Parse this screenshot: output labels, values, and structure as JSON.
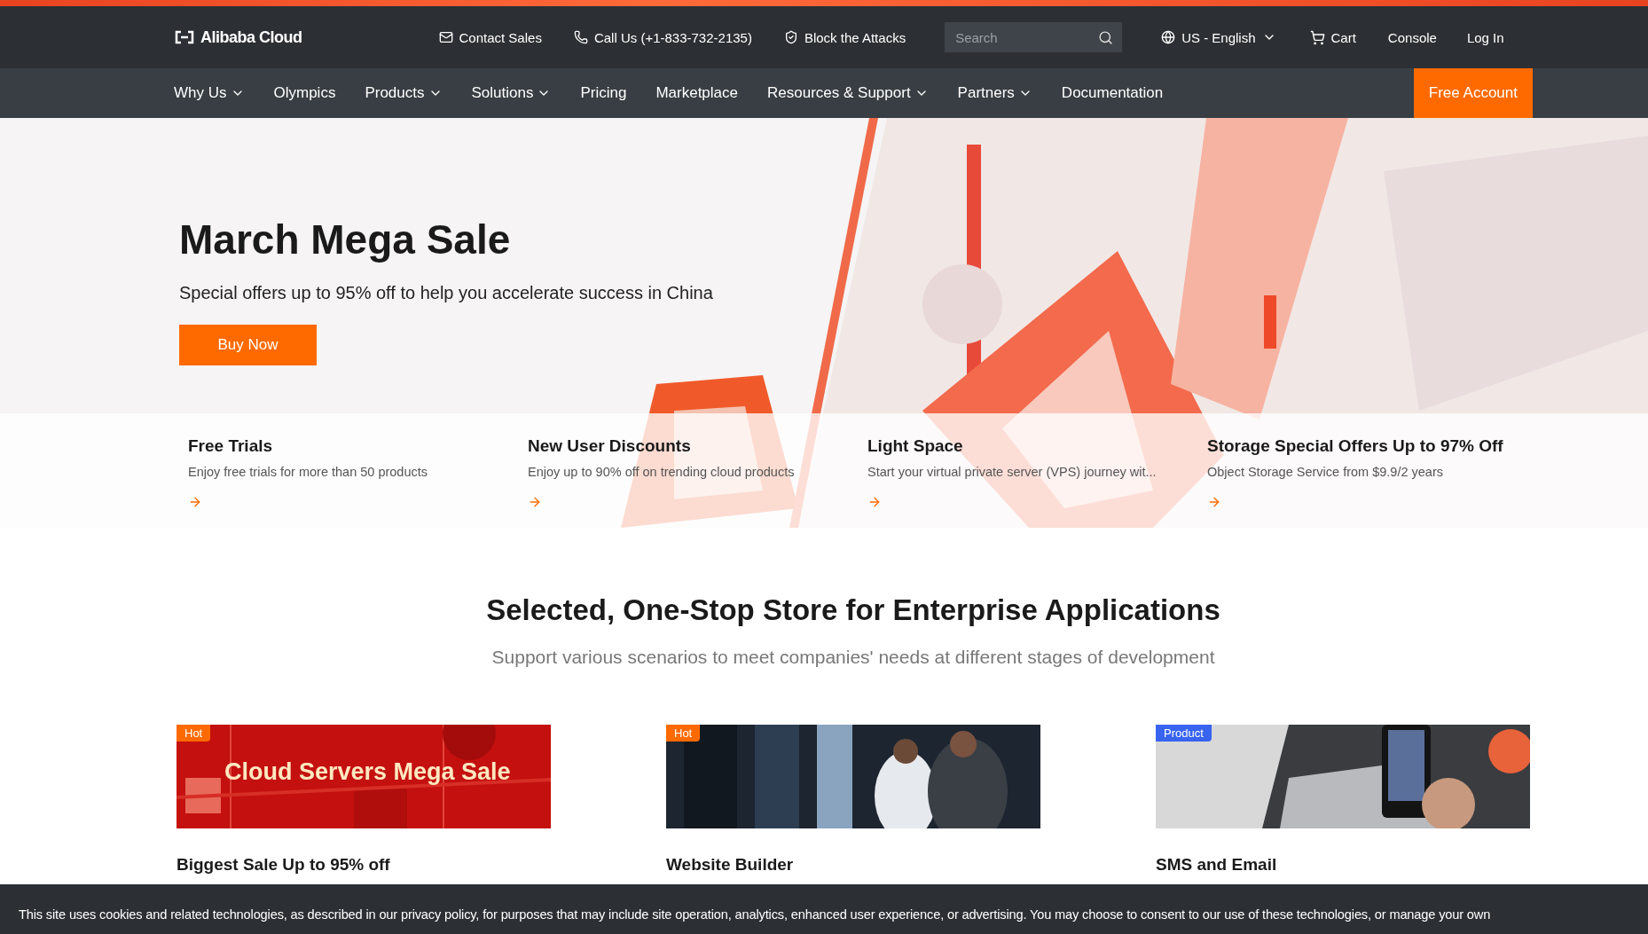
{
  "top_bar": {
    "logo": "Alibaba Cloud",
    "links": [
      {
        "kind": "mail",
        "label": "Contact Sales"
      },
      {
        "kind": "phone",
        "label": "Call Us (+1-833-732-2135)"
      },
      {
        "kind": "shield",
        "label": "Block the Attacks"
      }
    ],
    "search": {
      "placeholder": "Search"
    },
    "language": "US - English",
    "cart": "Cart",
    "console": "Console",
    "login": "Log In"
  },
  "nav": {
    "items": [
      {
        "label": "Why Us",
        "dropdown": true
      },
      {
        "label": "Olympics",
        "dropdown": false
      },
      {
        "label": "Products",
        "dropdown": true
      },
      {
        "label": "Solutions",
        "dropdown": true
      },
      {
        "label": "Pricing",
        "dropdown": false
      },
      {
        "label": "Marketplace",
        "dropdown": false
      },
      {
        "label": "Resources & Support",
        "dropdown": true
      },
      {
        "label": "Partners",
        "dropdown": true
      },
      {
        "label": "Documentation",
        "dropdown": false
      }
    ],
    "cta": "Free Account"
  },
  "hero": {
    "title": "March Mega Sale",
    "subtitle": "Special offers up to 95% off to help you accelerate success in China",
    "button": "Buy Now",
    "cards": [
      {
        "title": "Free Trials",
        "text": "Enjoy free trials for more than 50 products"
      },
      {
        "title": "New User Discounts",
        "text": "Enjoy up to 90% off on trending cloud products"
      },
      {
        "title": "Light Space",
        "text": "Start your virtual private server (VPS) journey wit..."
      },
      {
        "title": "Storage Special Offers Up to 97% Off",
        "text": "Object Storage Service from $9.9/2 years"
      }
    ]
  },
  "section": {
    "title": "Selected, One-Stop Store for Enterprise Applications",
    "subtitle": "Support various scenarios to meet companies' needs at different stages of development",
    "products": [
      {
        "badge": "Hot",
        "color": "#ff6a00",
        "banner_text": "Cloud Servers Mega Sale",
        "title": "Biggest Sale Up to 95% off"
      },
      {
        "badge": "Hot",
        "color": "#ff6a00",
        "title": "Website Builder"
      },
      {
        "badge": "Product",
        "color": "#3864f0",
        "title": "SMS and Email"
      }
    ]
  },
  "cookie_bar": {
    "text": "This site uses cookies and related technologies, as described in our privacy policy, for purposes that may include site operation, analytics, enhanced user experience, or advertising. You may choose to consent to our use of these technologies, or manage your own"
  }
}
